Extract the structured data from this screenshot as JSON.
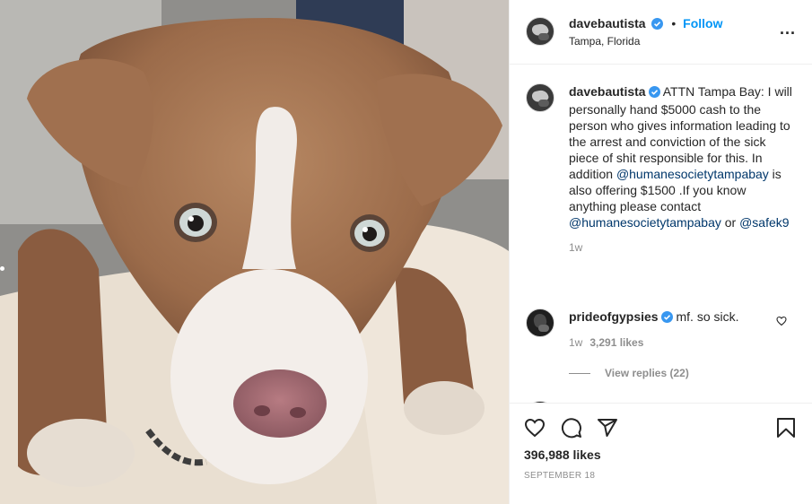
{
  "post": {
    "image_alt": "Brown and white puppy lying on a blanket",
    "colors": {
      "accent": "#0095f6",
      "mention": "#00376b",
      "muted": "#8e8e8e",
      "text": "#262626"
    }
  },
  "header": {
    "username": "davebautista",
    "verified_icon": "verified-badge-icon",
    "separator": "•",
    "follow_label": "Follow",
    "location": "Tampa, Florida",
    "more_label": "..."
  },
  "caption": {
    "username": "davebautista",
    "text_1": "ATTN Tampa Bay: I will personally hand $5000 cash to the person who gives information leading to the arrest and conviction of the sick piece of shit responsible for this. In addition ",
    "mention_1": "@humanesocietytampabay",
    "text_2": " is also offering $1500 .If you know anything please contact ",
    "mention_2": "@humanesocietytampabay",
    "text_3": " or ",
    "mention_3": "@safek9",
    "time": "1w"
  },
  "comment": {
    "username": "prideofgypsies",
    "text": "mf. so sick.",
    "time": "1w",
    "likes": "3,291 likes",
    "view_replies": "View replies (22)"
  },
  "actions": {
    "icons": [
      "heart-icon",
      "comment-icon",
      "share-icon",
      "bookmark-icon"
    ],
    "likes": "396,988 likes",
    "date": "SEPTEMBER 18"
  }
}
